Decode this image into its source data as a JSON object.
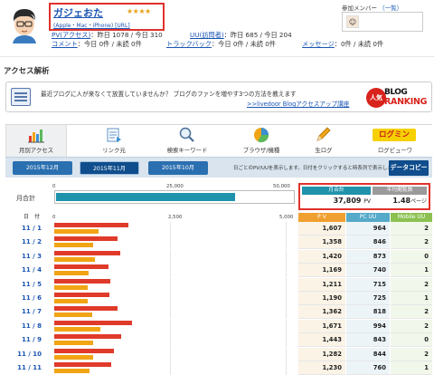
{
  "profile": {
    "name": "ガジェおた",
    "stars": "★★★★",
    "tagline": "(Apple・Mac・iPhone) [URL]",
    "stats": {
      "pv_label": "PV(アクセス)",
      "pv_value": "：昨日 1078 / 今日 310",
      "uu_label": "UU(訪問者)",
      "uu_value": "：昨日 685 / 今日 204",
      "comment_label": "コメント",
      "comment_value": "：今日 0件 / 未読 0件",
      "trackback_label": "トラックバック",
      "trackback_value": "：今日 0件 / 未読 0件",
      "message_label": "メッセージ",
      "message_value": "：0件 / 未読 0件"
    }
  },
  "members": {
    "label": "参加メンバー",
    "list_link": "（一覧）"
  },
  "page_title": "アクセス解析",
  "promo": {
    "text": "最近ブログに人が来なくて放置していませんか？ ブログのファンを増やす3つの方法を教えます",
    "link": ">>livedoor Blogアクセスアップ講座",
    "logo_line1": "BLOG",
    "logo_line2": "RANKING",
    "logo_circle": "人気"
  },
  "tabs": [
    {
      "label": "月別アクセス",
      "icon": "bar-chart-icon",
      "active": true
    },
    {
      "label": "リンク元",
      "icon": "link-source-icon",
      "active": false
    },
    {
      "label": "検索キーワード",
      "icon": "magnifier-icon",
      "active": false
    },
    {
      "label": "ブラウザ/機種",
      "icon": "pie-chart-icon",
      "active": false
    },
    {
      "label": "生ログ",
      "icon": "pencil-log-icon",
      "active": false
    },
    {
      "label": "ログミン",
      "icon": "logmin-logo",
      "active": false
    },
    {
      "label": "ログビューワ",
      "icon": "log-viewer-icon",
      "active": false
    }
  ],
  "months": [
    "2015年12月",
    "2015年11月",
    "2015年10月"
  ],
  "selected_month": "2015年11月",
  "date_hint": "日ごとのPV/UUを表示します。日付をクリックすると時系列で表示します。",
  "copy_button": "データコピー",
  "monthly": {
    "label": "月合計",
    "scale": [
      "0",
      "25,000",
      "50,000"
    ],
    "pv_fraction_of_max": 0.756,
    "total_header": "月合計",
    "avg_header": "平均閲覧数",
    "total_value": "37,809",
    "total_unit": "PV",
    "avg_value": "1.48",
    "avg_unit": "ページ"
  },
  "daily": {
    "date_header": "日　付",
    "scale": [
      "0",
      "2,500",
      "5,000"
    ],
    "max": 5000,
    "columns": [
      "P V",
      "PC UU",
      "Mobile UU"
    ],
    "rows": [
      {
        "date": "11 / 1",
        "pv": "1,607",
        "pc": "964",
        "mobile": "2"
      },
      {
        "date": "11 / 2",
        "pv": "1,358",
        "pc": "846",
        "mobile": "2"
      },
      {
        "date": "11 / 3",
        "pv": "1,420",
        "pc": "873",
        "mobile": "0"
      },
      {
        "date": "11 / 4",
        "pv": "1,169",
        "pc": "740",
        "mobile": "1"
      },
      {
        "date": "11 / 5",
        "pv": "1,211",
        "pc": "715",
        "mobile": "2"
      },
      {
        "date": "11 / 6",
        "pv": "1,190",
        "pc": "725",
        "mobile": "1"
      },
      {
        "date": "11 / 7",
        "pv": "1,362",
        "pc": "818",
        "mobile": "2"
      },
      {
        "date": "11 / 8",
        "pv": "1,671",
        "pc": "994",
        "mobile": "2"
      },
      {
        "date": "11 / 9",
        "pv": "1,443",
        "pc": "843",
        "mobile": "0"
      },
      {
        "date": "11 / 10",
        "pv": "1,282",
        "pc": "844",
        "mobile": "2"
      },
      {
        "date": "11 / 11",
        "pv": "1,230",
        "pc": "760",
        "mobile": "1"
      }
    ]
  },
  "colors": {
    "accent_blue": "#2a6fb0",
    "header_cyan": "#1f93ab",
    "pv_header": "#f0a030",
    "pc_header": "#55a9c9",
    "mobile_header": "#8cc151",
    "bar_red": "#e03a2a",
    "bar_orange": "#f1a414",
    "highlight_red": "#e0322b"
  }
}
